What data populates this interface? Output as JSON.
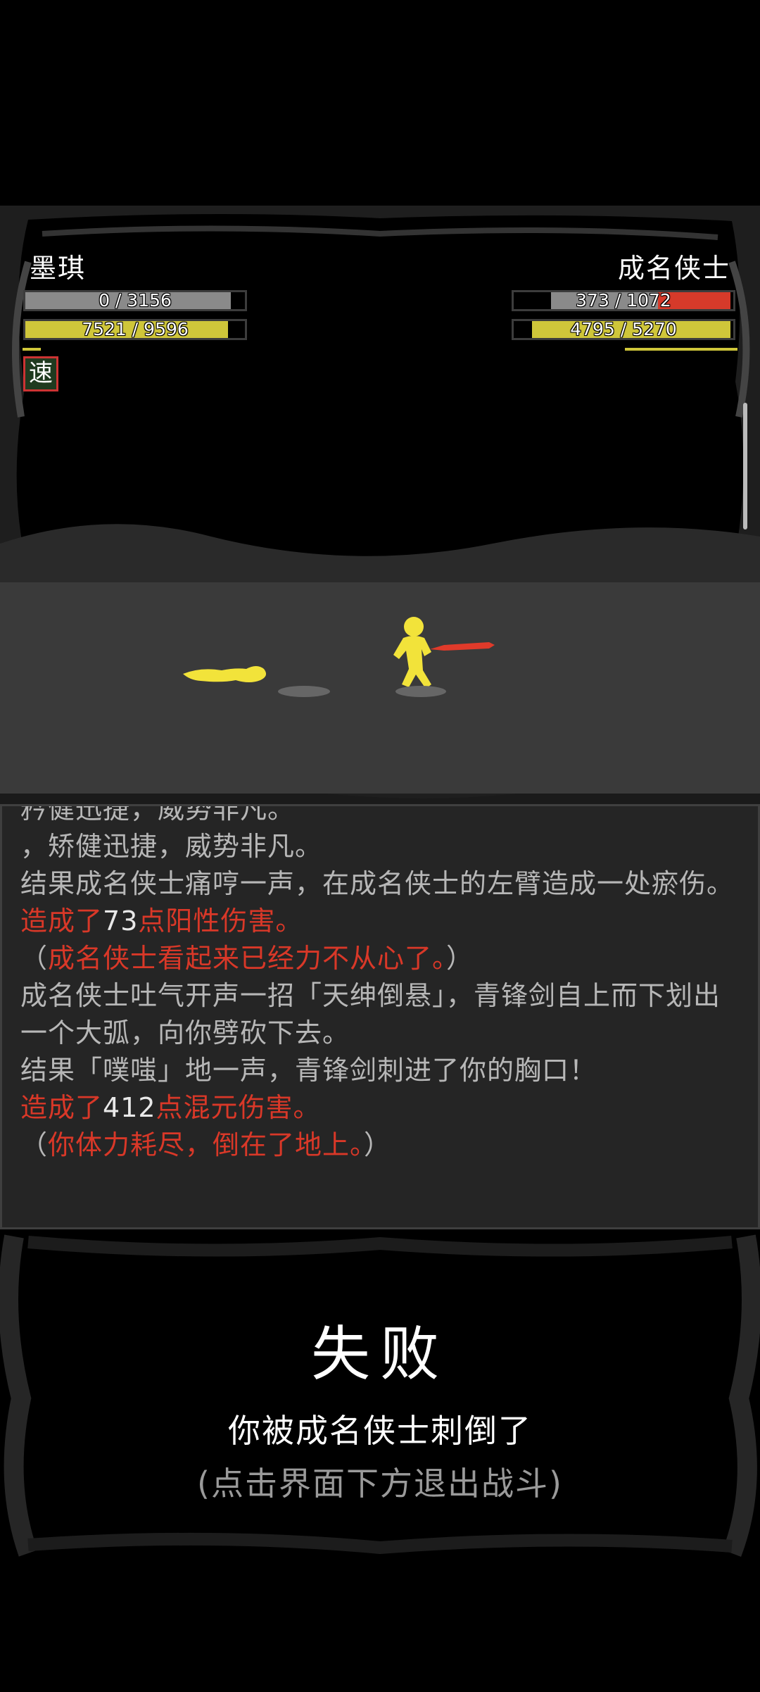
{
  "player": {
    "name": "墨琪",
    "hp_text": "0 / 3156",
    "mp_text": "7521 / 9596",
    "status_icon": "速"
  },
  "enemy": {
    "name": "成名侠士",
    "hp_text": "373 / 1072",
    "mp_text": "4795 / 5270"
  },
  "colors": {
    "damage_red": "#d93828",
    "energy_yellow": "#cfc63a",
    "figure_yellow": "#f2e33a",
    "sword_red": "#e03a2a"
  },
  "log": {
    "lines": [
      "矜健迅捷，威势非凡。",
      "，矫健迅捷，威势非凡。",
      "结果成名侠士痛哼一声，在成名侠士的左臂造成一处瘀伤。",
      "造成了",
      "73",
      "点阳性伤害。",
      "（",
      "成名侠士看起来已经力不从心了。",
      "）",
      "成名侠士吐气开声一招「天绅倒悬」，青锋剑自上而下划出一个大弧，向你劈砍下去。",
      "结果「噗嗤」地一声，青锋剑刺进了你的胸口！",
      "造成了",
      "412",
      "点混元伤害。",
      "（",
      "你体力耗尽，倒在了地上。",
      "）"
    ]
  },
  "result": {
    "title": "失败",
    "description": "你被成名侠士刺倒了",
    "hint": "(点击界面下方退出战斗)"
  }
}
